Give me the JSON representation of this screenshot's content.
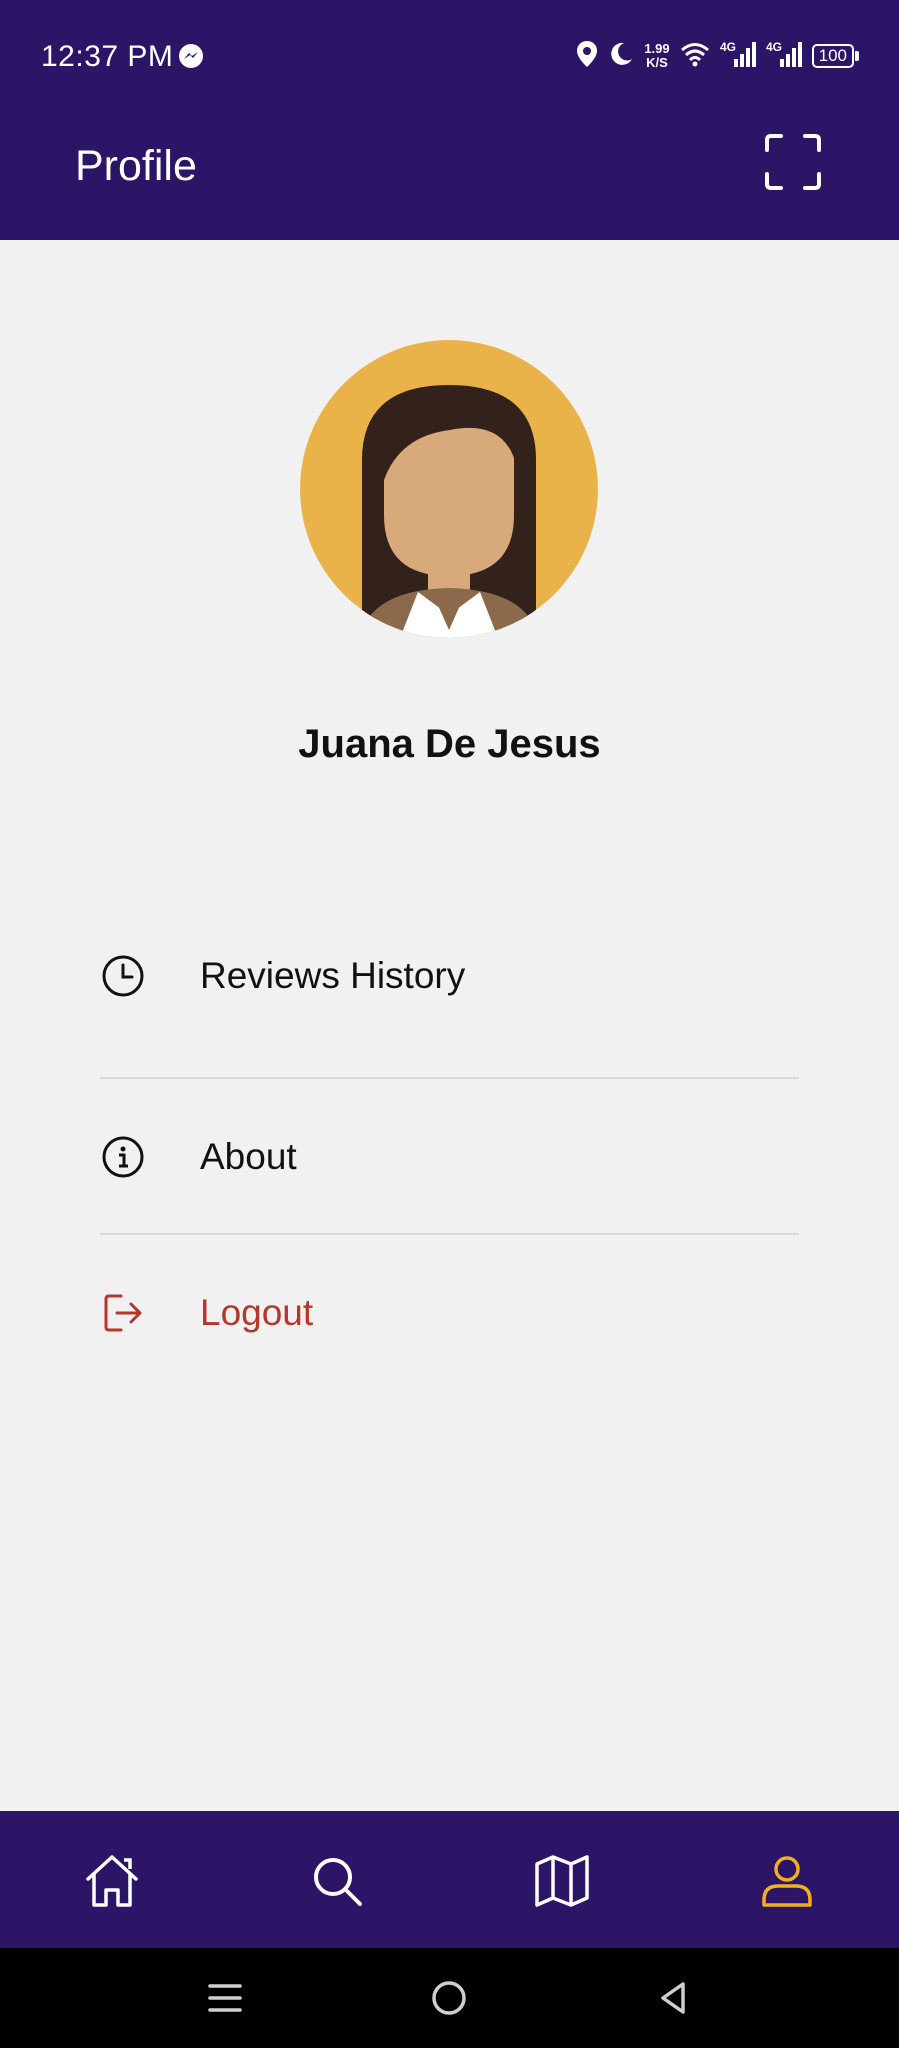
{
  "status_bar": {
    "time": "12:37 PM",
    "net_speed_value": "1.99",
    "net_speed_unit": "K/S",
    "network_1": "4G",
    "network_2": "4G",
    "battery": "100",
    "icons": [
      "messenger-icon",
      "location-icon",
      "moon-icon",
      "wifi-icon",
      "signal-icon",
      "battery-icon"
    ]
  },
  "app_bar": {
    "title": "Profile",
    "action_icon": "scan-icon"
  },
  "profile": {
    "name": "Juana De Jesus",
    "avatar_icon": "avatar-woman-illustration"
  },
  "menu": {
    "items": [
      {
        "label": "Reviews History",
        "icon": "clock-icon"
      },
      {
        "label": "About",
        "icon": "info-icon"
      },
      {
        "label": "Logout",
        "icon": "logout-icon"
      }
    ]
  },
  "bottom_nav": {
    "items": [
      {
        "name": "home",
        "icon": "home-icon",
        "active": false
      },
      {
        "name": "search",
        "icon": "search-icon",
        "active": false
      },
      {
        "name": "map",
        "icon": "map-icon",
        "active": false
      },
      {
        "name": "profile",
        "icon": "user-icon",
        "active": true
      }
    ]
  },
  "colors": {
    "primary": "#2c1467",
    "background": "#f1f1f1",
    "accent_active": "#f2b01e",
    "logout": "#b3372a",
    "avatar_bg": "#e9b34a"
  }
}
